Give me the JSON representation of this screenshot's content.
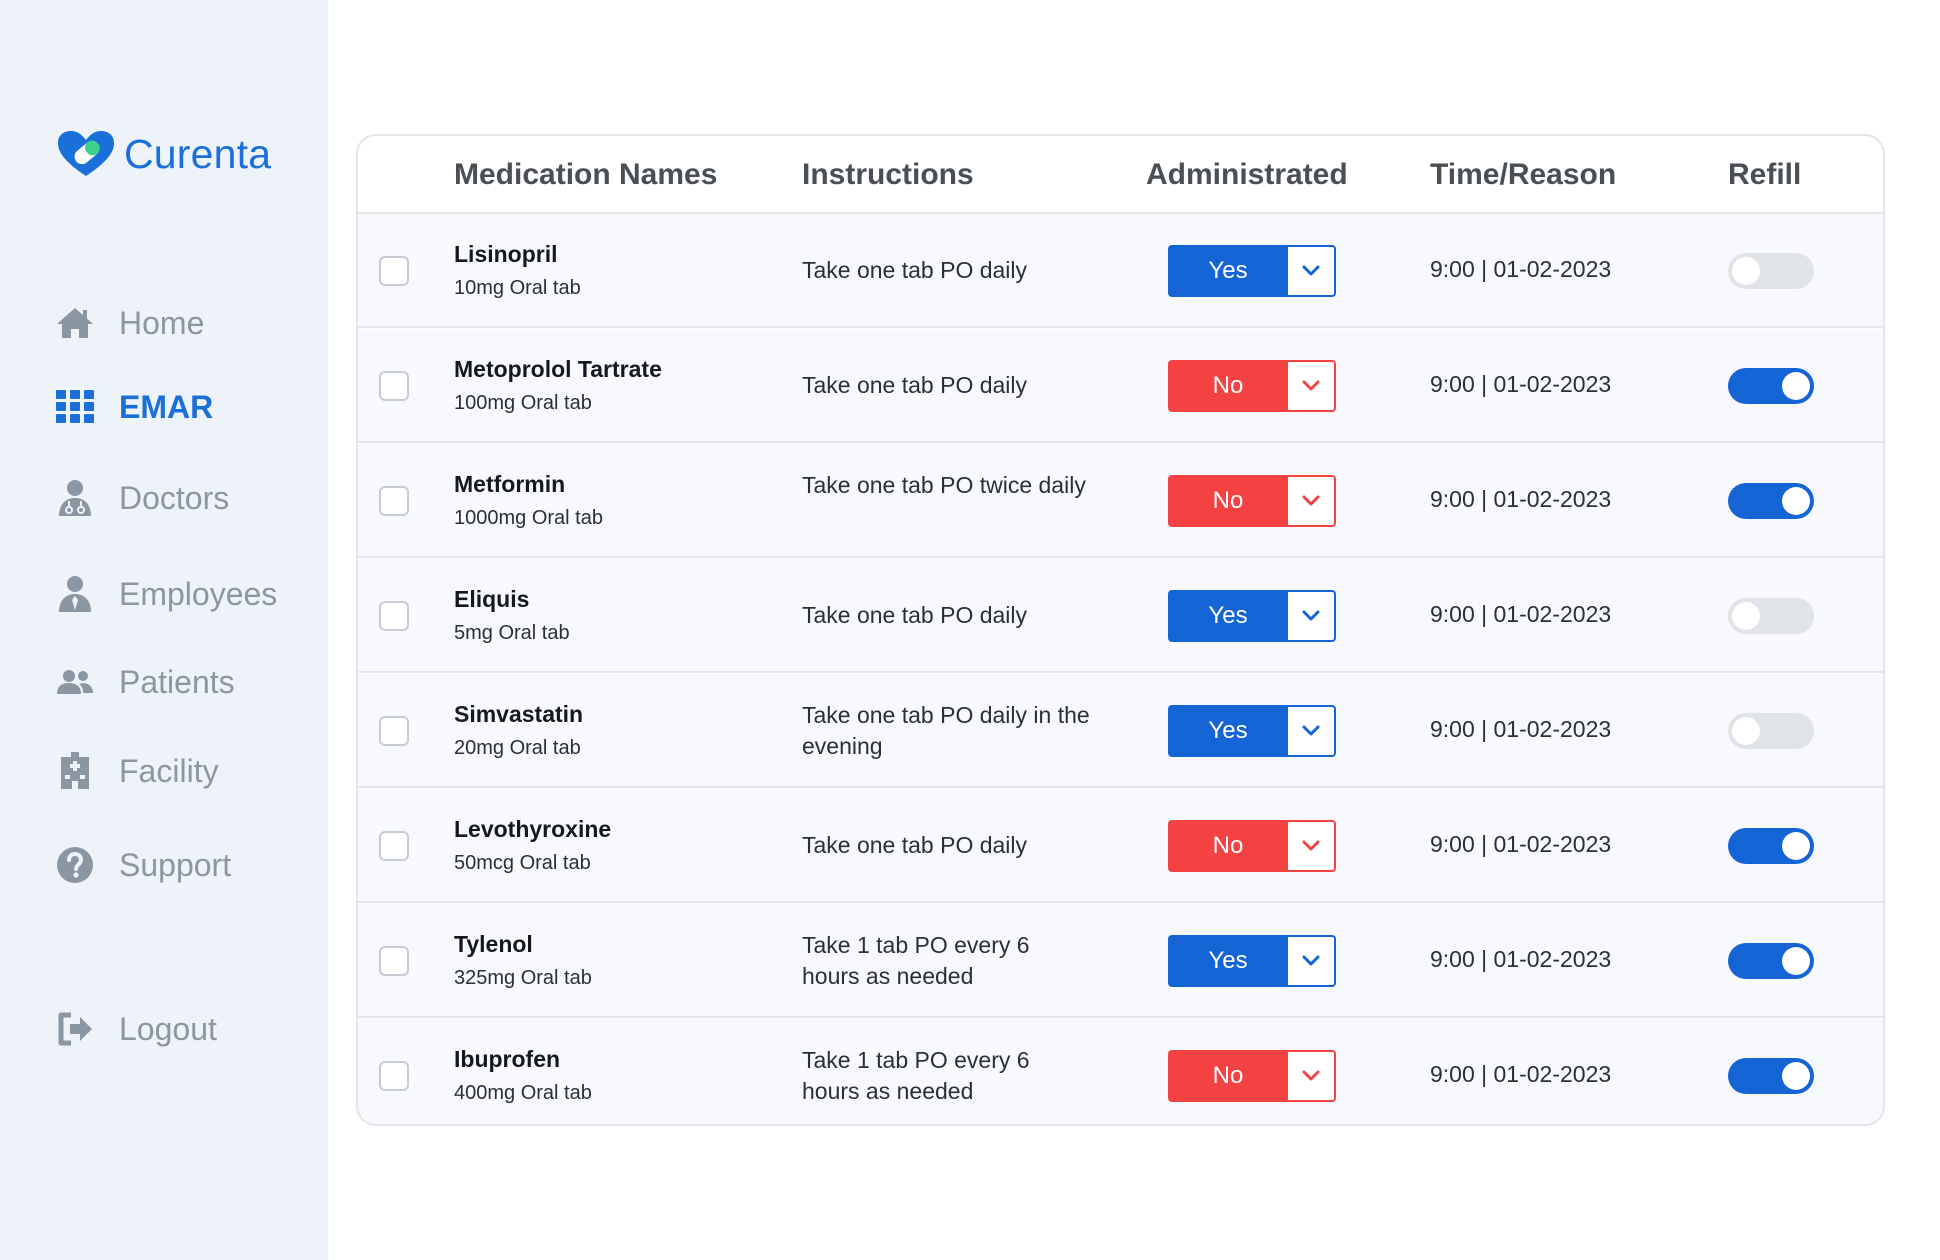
{
  "app": {
    "brand": "Curenta",
    "colors": {
      "primary": "#1a6fd8",
      "yes": "#1464d6",
      "no": "#f44242",
      "sidebar_bg": "#eef3fa"
    }
  },
  "sidebar": {
    "items": [
      {
        "label": "Home",
        "icon": "home-icon"
      },
      {
        "label": "EMAR",
        "icon": "grid-icon",
        "active": true
      },
      {
        "label": "Doctors",
        "icon": "doctor-icon"
      },
      {
        "label": "Employees",
        "icon": "employee-icon"
      },
      {
        "label": "Patients",
        "icon": "patients-icon"
      },
      {
        "label": "Facility",
        "icon": "building-icon"
      },
      {
        "label": "Support",
        "icon": "help-icon"
      }
    ],
    "logout": {
      "label": "Logout",
      "icon": "logout-icon"
    }
  },
  "table": {
    "headers": {
      "name": "Medication Names",
      "instructions": "Instructions",
      "administrated": "Administrated",
      "time": "Time/Reason",
      "refill": "Refill"
    },
    "rows": [
      {
        "name": "Lisinopril",
        "dose": "10mg Oral tab",
        "instructions": "Take one tab PO daily",
        "administrated": "Yes",
        "time": "9:00 | 01-02-2023",
        "refill": false
      },
      {
        "name": "Metoprolol Tartrate",
        "dose": "100mg Oral tab",
        "instructions": "Take one tab PO daily",
        "administrated": "No",
        "time": "9:00 | 01-02-2023",
        "refill": true
      },
      {
        "name": "Metformin",
        "dose": "1000mg Oral tab",
        "instructions": "Take one tab PO twice daily",
        "administrated": "No",
        "time": "9:00 | 01-02-2023",
        "refill": true
      },
      {
        "name": "Eliquis",
        "dose": "5mg Oral tab",
        "instructions": "Take one tab PO daily",
        "administrated": "Yes",
        "time": "9:00 | 01-02-2023",
        "refill": false
      },
      {
        "name": "Simvastatin",
        "dose": "20mg Oral tab",
        "instructions": "Take one tab PO daily in the evening",
        "administrated": "Yes",
        "time": "9:00 | 01-02-2023",
        "refill": false
      },
      {
        "name": "Levothyroxine",
        "dose": "50mcg Oral tab",
        "instructions": "Take one tab PO daily",
        "administrated": "No",
        "time": "9:00 | 01-02-2023",
        "refill": true
      },
      {
        "name": "Tylenol",
        "dose": "325mg Oral tab",
        "instructions": "Take 1 tab PO every 6 hours as needed",
        "administrated": "Yes",
        "time": "9:00 | 01-02-2023",
        "refill": true
      },
      {
        "name": "Ibuprofen",
        "dose": "400mg Oral tab",
        "instructions": "Take 1 tab PO every 6 hours as needed",
        "administrated": "No",
        "time": "9:00 | 01-02-2023",
        "refill": true
      }
    ]
  }
}
